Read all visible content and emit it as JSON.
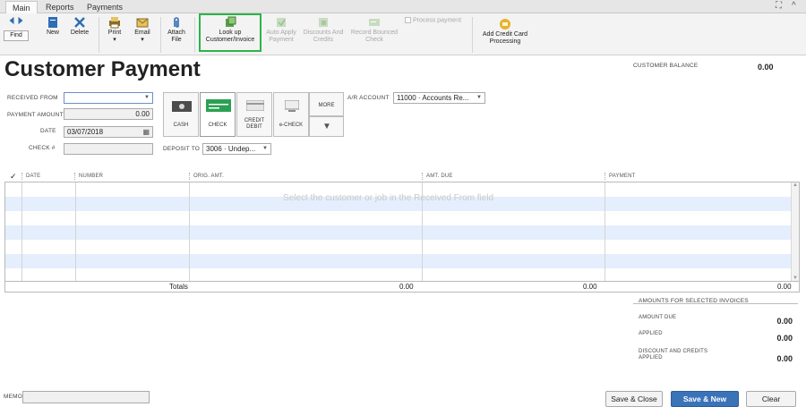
{
  "tabs": [
    "Main",
    "Reports",
    "Payments"
  ],
  "window_controls": {
    "expand": "⛶",
    "collapse": "^"
  },
  "toolbar": {
    "find": "Find",
    "new": "New",
    "delete": "Delete",
    "print": "Print",
    "email": "Email",
    "attach_file": "Attach File",
    "lookup": "Look up Customer/Invoice",
    "auto_apply": "Auto Apply Payment",
    "discounts": "Discounts And Credits",
    "record_bounced": "Record Bounced Check",
    "process_payment": "Process payment",
    "add_cc": "Add Credit Card Processing"
  },
  "title": "Customer Payment",
  "customer_balance": {
    "label": "CUSTOMER BALANCE",
    "value": "0.00"
  },
  "form": {
    "received_from_label": "RECEIVED FROM",
    "received_from_value": "",
    "payment_amount_label": "PAYMENT AMOUNT",
    "payment_amount_value": "0.00",
    "date_label": "DATE",
    "date_value": "03/07/2018",
    "check_label": "CHECK #",
    "check_value": "",
    "deposit_to_label": "DEPOSIT TO",
    "deposit_to_value": "3006 · Undep...",
    "ar_account_label": "A/R ACCOUNT",
    "ar_account_value": "11000 · Accounts Re..."
  },
  "payment_methods": [
    {
      "label": "CASH"
    },
    {
      "label": "CHECK"
    },
    {
      "label": "CREDIT DEBIT"
    },
    {
      "label": "e-CHECK"
    }
  ],
  "more_label": "MORE",
  "grid": {
    "columns": [
      "✓",
      "DATE",
      "NUMBER",
      "ORIG. AMT.",
      "AMT. DUE",
      "PAYMENT"
    ],
    "empty_message": "Select the customer or job in the Received From field",
    "totals_label": "Totals",
    "totals": [
      "0.00",
      "0.00",
      "0.00"
    ]
  },
  "amounts": {
    "title": "AMOUNTS FOR SELECTED INVOICES",
    "amount_due_label": "AMOUNT DUE",
    "amount_due": "0.00",
    "applied_label": "APPLIED",
    "applied": "0.00",
    "discount_label": "DISCOUNT AND CREDITS APPLIED",
    "discount": "0.00"
  },
  "memo_label": "MEMO",
  "memo_value": "",
  "buttons": {
    "save_close": "Save & Close",
    "save_new": "Save & New",
    "clear": "Clear"
  },
  "colors": {
    "highlight": "#2db34a",
    "primary": "#3b73b9",
    "row_alt": "#e5eefc"
  }
}
